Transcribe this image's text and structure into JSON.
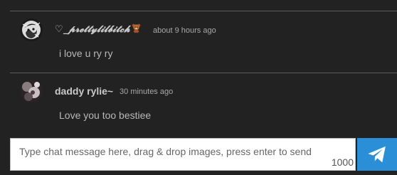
{
  "messages": [
    {
      "username": "♡_𝓹𝓻𝓮𝓽𝓽𝔂𝓵𝓲𝓵𝓫𝓲𝓽𝓬𝓱",
      "username_icon": "teddy-bear-icon",
      "time": "about 9 hours ago",
      "text": "i love u ry ry"
    },
    {
      "username": "daddy rylie~",
      "time": "30 minutes ago",
      "text": "Love you too bestiee"
    }
  ],
  "composer": {
    "placeholder": "Type chat message here, drag & drop images, press enter to send",
    "char_count": "1000",
    "send_icon": "paper-plane-icon"
  },
  "colors": {
    "background": "#222222",
    "send_button": "#2a8fd6"
  }
}
